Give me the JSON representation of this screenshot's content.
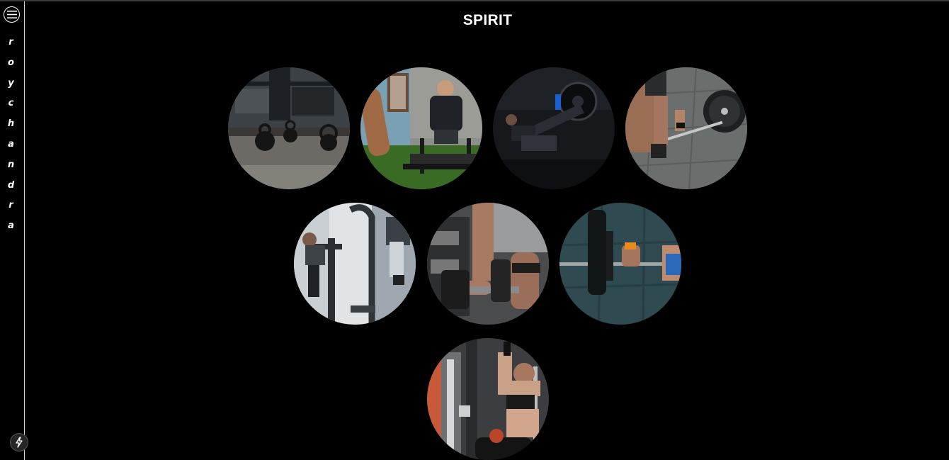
{
  "sidebar": {
    "menu_icon": "hamburger-menu-icon",
    "letters": [
      "r",
      "o",
      "y",
      "c",
      "h",
      "a",
      "n",
      "d",
      "r",
      "a"
    ],
    "bolt_icon": "lightning-bolt-icon"
  },
  "page": {
    "title": "SPIRIT"
  },
  "gallery": [
    {
      "id": "kettlebells",
      "subject": "kettlebells-photo"
    },
    {
      "id": "sled-push",
      "subject": "sled-push-photo"
    },
    {
      "id": "leg-press",
      "subject": "leg-press-photo"
    },
    {
      "id": "barbell-deadlift",
      "subject": "barbell-deadlift-photo"
    },
    {
      "id": "stair-climber",
      "subject": "stair-climber-photo"
    },
    {
      "id": "dumbbell-grip",
      "subject": "dumbbell-grip-photo"
    },
    {
      "id": "barbell-floor",
      "subject": "barbell-floor-photo"
    },
    {
      "id": "cable-pulldown",
      "subject": "cable-pulldown-photo"
    }
  ]
}
